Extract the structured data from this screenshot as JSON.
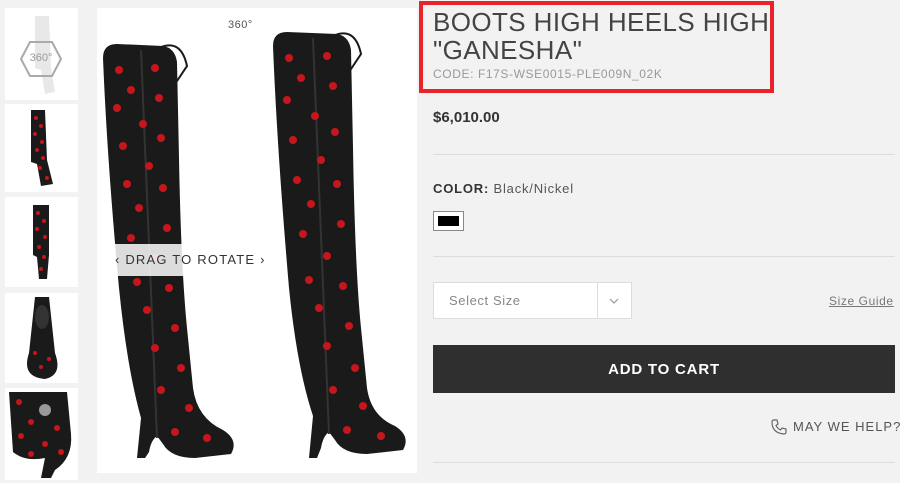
{
  "gallery": {
    "thumbnails": [
      {
        "name": "360-view",
        "label": "360°"
      },
      {
        "name": "side-view"
      },
      {
        "name": "front-view"
      },
      {
        "name": "top-view"
      },
      {
        "name": "heel-detail"
      }
    ],
    "badge_360": "360°",
    "drag_hint": "‹ DRAG TO ROTATE ›"
  },
  "product": {
    "title": "BOOTS HIGH HEELS HIGH \"GANESHA\"",
    "code": "CODE: F17S-WSE0015-PLE009N_02K",
    "price": "$6,010.00",
    "color_label": "COLOR:",
    "color_value": "Black/Nickel",
    "swatch_color": "#000000"
  },
  "size": {
    "placeholder": "Select Size",
    "guide_label": "Size Guide"
  },
  "actions": {
    "add_to_cart": "ADD TO CART",
    "help": "MAY WE HELP?"
  },
  "colors": {
    "highlight": "#e8232a",
    "button": "#2f2f2f",
    "boot_black": "#1a1a1a",
    "heart_red": "#c4161c"
  }
}
